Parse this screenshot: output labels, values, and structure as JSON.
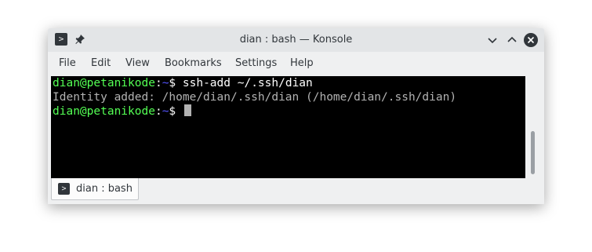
{
  "window": {
    "title": "dian : bash — Konsole",
    "app_icon": "terminal-icon",
    "pin_icon": "pin-icon",
    "controls": [
      "minimize-chevron-down-icon",
      "maximize-chevron-up-icon",
      "close-icon"
    ]
  },
  "menubar": {
    "items": [
      {
        "label": "File"
      },
      {
        "label": "Edit"
      },
      {
        "label": "View"
      },
      {
        "label": "Bookmarks"
      },
      {
        "label": "Settings"
      },
      {
        "label": "Help"
      }
    ]
  },
  "terminal": {
    "lines": [
      {
        "user_host": "dian@petanikode",
        "sep": ":",
        "path": "~",
        "prompt": "$ ",
        "command": "ssh-add ~/.ssh/dian"
      },
      {
        "output": "Identity added: /home/dian/.ssh/dian (/home/dian/.ssh/dian)"
      },
      {
        "user_host": "dian@petanikode",
        "sep": ":",
        "path": "~",
        "prompt": "$ ",
        "command": ""
      }
    ],
    "colors": {
      "background": "#000000",
      "user_host": "#54ff54",
      "path": "#5454ff",
      "text": "#ffffff",
      "output": "#b2b2b2"
    }
  },
  "tabs": [
    {
      "label": "dian : bash",
      "icon": "terminal-icon"
    }
  ]
}
